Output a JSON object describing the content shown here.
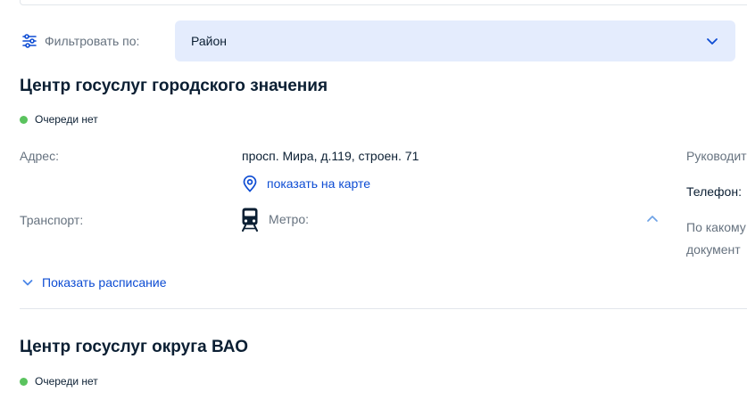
{
  "filter": {
    "label": "Фильтровать по:",
    "selected": "Район"
  },
  "centers": [
    {
      "title": "Центр госуслуг городского значения",
      "queue_status": "Очереди нет",
      "address_label": "Адрес:",
      "address_value": "просп. Мира, д.119, строен. 71",
      "map_link": "показать на карте",
      "transport_label": "Транспорт:",
      "metro_label": "Метро:",
      "right_head_label": "Руководит",
      "phone_label": "Телефон:",
      "question_line1": "По какому",
      "question_line2": "документ",
      "schedule_toggle": "Показать расписание"
    },
    {
      "title": "Центр госуслуг округа ВАО",
      "queue_status": "Очереди нет"
    }
  ],
  "colors": {
    "status_ok": "#5ac35e",
    "link": "#0d4cd3",
    "select_bg": "#e4ecfd",
    "muted_text": "#66727f",
    "main_text": "#0b1f33",
    "divider": "#e2e6eb"
  },
  "icons": {
    "filter": "sliders-icon",
    "select_chevron": "chevron-down-icon",
    "map": "map-pin-icon",
    "transport": "train-icon",
    "metro_toggle": "chevron-up-icon",
    "schedule": "chevron-down-icon"
  }
}
